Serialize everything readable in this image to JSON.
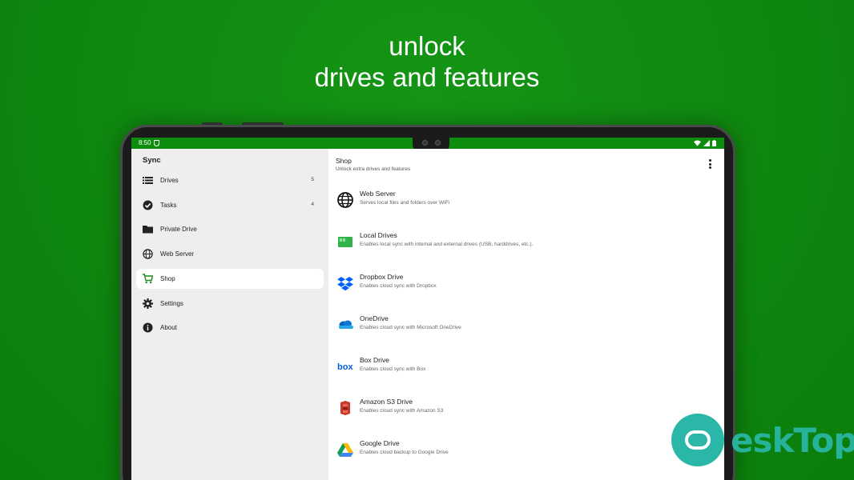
{
  "promo": {
    "headline_line1": "unlock",
    "headline_line2": "drives and features"
  },
  "status_bar": {
    "time": "8:50"
  },
  "sidebar": {
    "title": "Sync",
    "items": [
      {
        "label": "Drives",
        "count": "5",
        "icon": "list-icon"
      },
      {
        "label": "Tasks",
        "count": "4",
        "icon": "check-circle-icon"
      },
      {
        "label": "Private Drive",
        "count": "",
        "icon": "folder-icon"
      },
      {
        "label": "Web Server",
        "count": "",
        "icon": "globe-icon"
      },
      {
        "label": "Shop",
        "count": "",
        "icon": "cart-icon",
        "active": true
      },
      {
        "label": "Settings",
        "count": "",
        "icon": "gear-icon"
      },
      {
        "label": "About",
        "count": "",
        "icon": "info-icon"
      }
    ]
  },
  "main": {
    "title": "Shop",
    "subtitle": "Unlock extra drives and features",
    "items": [
      {
        "title": "Web Server",
        "description": "Serves local files and folders over WiFi",
        "icon": "globe-icon"
      },
      {
        "title": "Local Drives",
        "description": "Enables local sync with internal and external drives (USB, harddrives, etc.).",
        "icon": "sd-card-icon"
      },
      {
        "title": "Dropbox Drive",
        "description": "Enables cloud sync with Dropbox",
        "icon": "dropbox-icon"
      },
      {
        "title": "OneDrive",
        "description": "Enables cloud sync with Microsoft OneDrive",
        "icon": "onedrive-icon"
      },
      {
        "title": "Box Drive",
        "description": "Enables cloud sync with Box",
        "icon": "box-icon"
      },
      {
        "title": "Amazon S3 Drive",
        "description": "Enables cloud sync with Amazon S3",
        "icon": "amazon-s3-icon"
      },
      {
        "title": "Google Drive",
        "description": "Enables cloud backup to Google Drive",
        "icon": "google-drive-icon"
      }
    ]
  },
  "colors": {
    "background": "#0f8a0f",
    "status_bar": "#0d8d0d",
    "sidebar": "#eeeeee",
    "watermark": "#2ab7a7"
  },
  "watermark": {
    "text": "eskTop"
  }
}
